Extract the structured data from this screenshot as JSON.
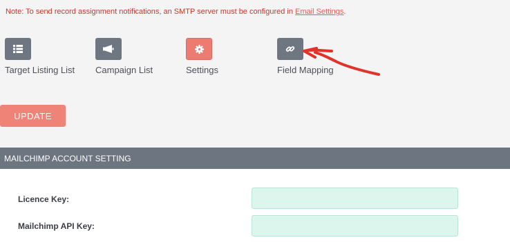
{
  "note": {
    "text": "Note: To send record assignment notifications, an SMTP server must be configured in ",
    "link": "Email Settings",
    "suffix": "."
  },
  "nav": [
    {
      "label": "Target Listing List",
      "icon": "list-icon"
    },
    {
      "label": "Campaign List",
      "icon": "megaphone-icon"
    },
    {
      "label": "Settings",
      "icon": "gear-icon"
    },
    {
      "label": "Field Mapping",
      "icon": "link-icon"
    }
  ],
  "update_label": "UPDATE",
  "section_title": "MAILCHIMP ACCOUNT SETTING",
  "fields": {
    "licence_key": {
      "label": "Licence Key:",
      "value": ""
    },
    "api_key": {
      "label": "Mailchimp API Key:",
      "value": ""
    }
  },
  "colors": {
    "note_text": "#c0392b",
    "icon_button": "#6e7682",
    "settings_button": "#ee7b72",
    "update_button": "#f08378",
    "section_bar": "#6c7580",
    "input_bg": "#dcf6ee",
    "annotation_arrow": "#e0342a"
  }
}
